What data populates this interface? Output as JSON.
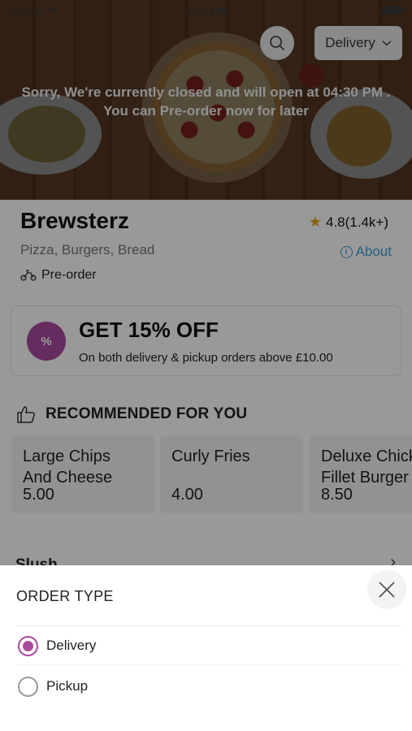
{
  "status_bar": {
    "carrier": "Carrier",
    "time": "5:20 PM"
  },
  "header": {
    "order_type_button": "Delivery",
    "closed_message_line1": "Sorry, We're currently closed and will open at 04:30 PM .",
    "closed_message_line2": "You can Pre-order now for later"
  },
  "restaurant": {
    "name": "Brewsterz",
    "rating": "4.8(1.4k+)",
    "cuisines": "Pizza, Burgers, Bread",
    "about_label": "About",
    "mode": "Pre-order"
  },
  "offer": {
    "title": "GET 15% OFF",
    "description": "On both delivery & pickup orders above £10.00",
    "badge_color": "#a84a9e"
  },
  "recommended": {
    "title": "RECOMMENDED FOR YOU",
    "items": [
      {
        "name": "Large Chips\nAnd Cheese",
        "price": "5.00"
      },
      {
        "name": "Curly Fries",
        "price": "4.00"
      },
      {
        "name": "Deluxe Chicken\nFillet Burger",
        "price": "8.50"
      }
    ]
  },
  "category": {
    "name": "Slush"
  },
  "order_type_sheet": {
    "title": "ORDER TYPE",
    "options": [
      {
        "label": "Delivery",
        "selected": true
      },
      {
        "label": "Pickup",
        "selected": false
      }
    ],
    "accent_color": "#a84a9e"
  }
}
